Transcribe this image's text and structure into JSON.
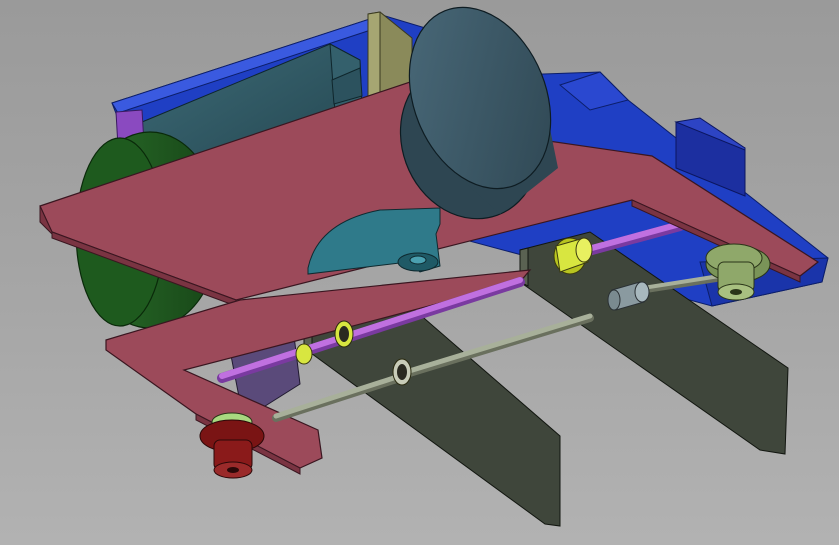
{
  "view": {
    "type": "3d-cad-assembly-viewport",
    "background_color": "#a3a3a3"
  },
  "model": {
    "parts": [
      {
        "part": "blue-base-tray",
        "color": "#1f3fc4"
      },
      {
        "part": "blue-end-block",
        "color": "#1c2fa0"
      },
      {
        "part": "green-wheel",
        "color": "#1e5a1e"
      },
      {
        "part": "motor-body",
        "color": "#2f5a66"
      },
      {
        "part": "top-mounting-plate",
        "color": "#9c4a5a"
      },
      {
        "part": "bottom-frame-plate",
        "color": "#9c4a5a"
      },
      {
        "part": "large-disc",
        "color": "#3c5a6a"
      },
      {
        "part": "sector-gear",
        "color": "#2f7a8a"
      },
      {
        "part": "olive-spacer-plate",
        "color": "#8a8a5a"
      },
      {
        "part": "purple-bracket",
        "color": "#8a4ac0"
      },
      {
        "part": "rear-vertical-arm",
        "color": "#3f463b"
      },
      {
        "part": "front-vertical-arm",
        "color": "#3f463b"
      },
      {
        "part": "purple-rod-upper",
        "color": "#c070e0"
      },
      {
        "part": "purple-rod-lower",
        "color": "#c070e0"
      },
      {
        "part": "grey-rod-upper",
        "color": "#a8b09a"
      },
      {
        "part": "grey-rod-lower",
        "color": "#a8b09a"
      },
      {
        "part": "yellow-bushing",
        "color": "#d8e640"
      },
      {
        "part": "grey-bushing",
        "color": "#8a9aa0"
      },
      {
        "part": "green-flange-bearing",
        "color": "#8fa86a"
      },
      {
        "part": "red-flange-bearing",
        "color": "#8a1a1a"
      },
      {
        "part": "lower-wedge-plate",
        "color": "#5a4a7a"
      }
    ]
  }
}
